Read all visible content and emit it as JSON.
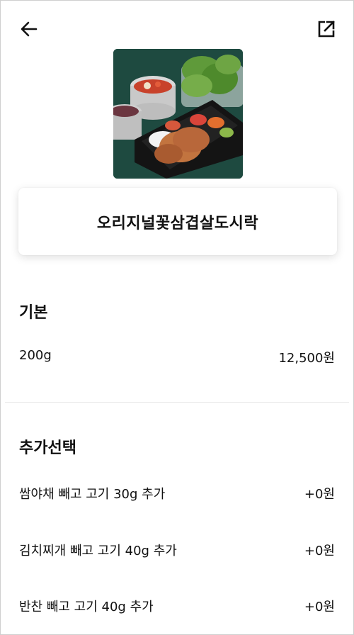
{
  "product": {
    "name": "오리지널꽃삼겹살도시락"
  },
  "base": {
    "section_title": "기본",
    "option_label": "200g",
    "option_price": "12,500원"
  },
  "extras": {
    "section_title": "추가선택",
    "items": [
      {
        "label": "쌈야채 빼고 고기 30g 추가",
        "price": "+0원"
      },
      {
        "label": "김치찌개 빼고 고기 40g 추가",
        "price": "+0원"
      },
      {
        "label": "반찬 빼고 고기 40g 추가",
        "price": "+0원"
      }
    ]
  },
  "icons": {
    "back": "arrow-left-icon",
    "share": "share-external-icon"
  },
  "colors": {
    "photo_background": "#1e4a40",
    "divider": "#e4e4e4"
  }
}
